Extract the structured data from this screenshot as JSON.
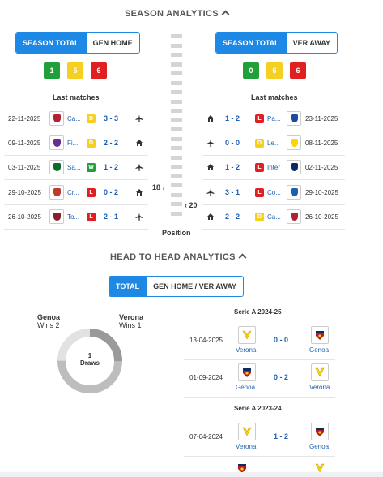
{
  "season": {
    "title": "SEASON ANALYTICS",
    "left_tabs": [
      "SEASON TOTAL",
      "GEN HOME"
    ],
    "right_tabs": [
      "SEASON TOTAL",
      "VER AWAY"
    ],
    "left_wdl": [
      "1",
      "5",
      "6"
    ],
    "right_wdl": [
      "0",
      "6",
      "6"
    ],
    "last_matches_label": "Last matches",
    "position_label": "Position",
    "left_position": "18",
    "right_position": "20",
    "left_matches": [
      {
        "date": "22-11-2025",
        "team": "Ca...",
        "result": "D",
        "score": "3 - 3",
        "venue": "away"
      },
      {
        "date": "09-11-2025",
        "team": "Fi...",
        "result": "D",
        "score": "2 - 2",
        "venue": "home"
      },
      {
        "date": "03-11-2025",
        "team": "Sa...",
        "result": "W",
        "score": "1 - 2",
        "venue": "away"
      },
      {
        "date": "29-10-2025",
        "team": "Cr...",
        "result": "L",
        "score": "0 - 2",
        "venue": "home"
      },
      {
        "date": "26-10-2025",
        "team": "To...",
        "result": "L",
        "score": "2 - 1",
        "venue": "away"
      }
    ],
    "right_matches": [
      {
        "date": "23-11-2025",
        "team": "Pa...",
        "result": "L",
        "score": "1 - 2",
        "venue": "home"
      },
      {
        "date": "08-11-2025",
        "team": "Le...",
        "result": "D",
        "score": "0 - 0",
        "venue": "away"
      },
      {
        "date": "02-11-2025",
        "team": "Inter",
        "result": "L",
        "score": "1 - 2",
        "venue": "home"
      },
      {
        "date": "29-10-2025",
        "team": "Co...",
        "result": "L",
        "score": "3 - 1",
        "venue": "away"
      },
      {
        "date": "26-10-2025",
        "team": "Ca...",
        "result": "D",
        "score": "2 - 2",
        "venue": "home"
      }
    ]
  },
  "h2h": {
    "title": "HEAD TO HEAD ANALYTICS",
    "tabs": [
      "TOTAL",
      "GEN HOME / VER AWAY"
    ],
    "home_team": "Genoa",
    "home_wins": "Wins 2",
    "away_team": "Verona",
    "away_wins": "Wins 1",
    "draws_num": "1",
    "draws_label": "Draws",
    "seasons": [
      {
        "label": "Serie A 2024-25",
        "matches": [
          {
            "date": "13-04-2025",
            "home": "Verona",
            "score": "0 - 0",
            "away": "Genoa"
          },
          {
            "date": "01-09-2024",
            "home": "Genoa",
            "score": "0 - 2",
            "away": "Verona"
          }
        ]
      },
      {
        "label": "Serie A 2023-24",
        "matches": [
          {
            "date": "07-04-2024",
            "home": "Verona",
            "score": "1 - 2",
            "away": "Genoa"
          }
        ]
      }
    ]
  },
  "colors": {
    "accent": "#1e88e5",
    "win": "#1fa03a",
    "draw": "#f5d020",
    "loss": "#e02020",
    "score_blue": "#1e5fb0"
  }
}
